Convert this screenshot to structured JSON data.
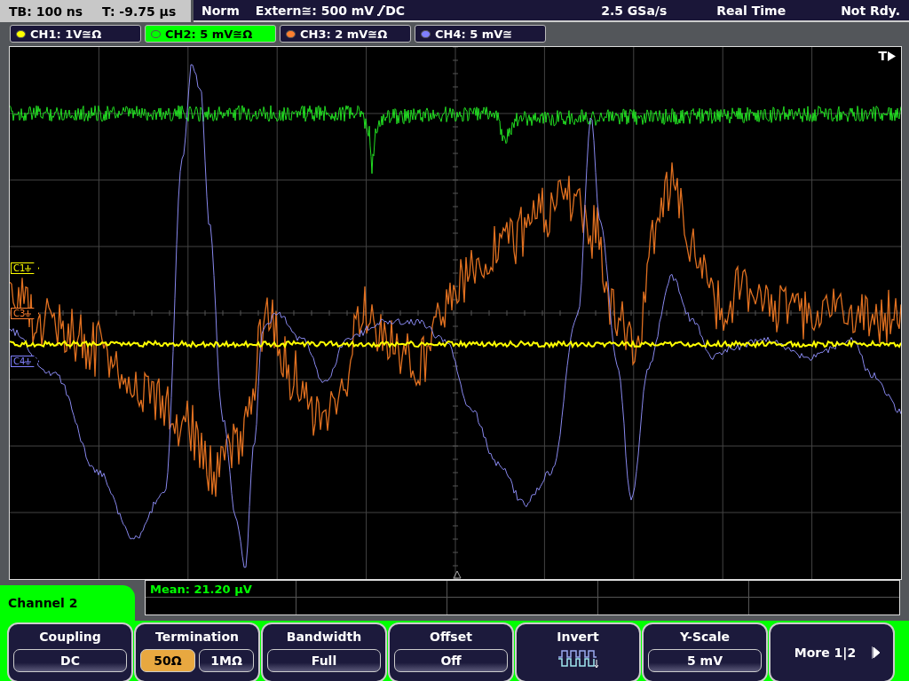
{
  "status_bar": {
    "timebase": "TB: 100 ns",
    "trigger_time": "T: -9.75 µs",
    "mode": "Norm",
    "trigger_source": "Extern≅: 500 mV",
    "trigger_coupling": "DC",
    "sample_rate": "2.5 GSa/s",
    "acquisition": "Real Time",
    "state": "Not Rdy."
  },
  "channel_tabs": [
    {
      "label": "CH1: 1V≅Ω",
      "color": "#ffff00",
      "selected": false
    },
    {
      "label": "CH2: 5 mV≅Ω",
      "color": "#00ff00",
      "selected": true
    },
    {
      "label": "CH3: 2 mV≅Ω",
      "color": "#ff8030",
      "selected": false
    },
    {
      "label": "CH4: 5 mV≅",
      "color": "#8080ff",
      "selected": false
    }
  ],
  "plot": {
    "trigger_label": "T",
    "markers": [
      {
        "label": "C1",
        "color": "#ffff00"
      },
      {
        "label": "C3",
        "color": "#ff8030"
      },
      {
        "label": "C4",
        "color": "#8080ff"
      }
    ]
  },
  "menu": {
    "title": "Channel 2",
    "measurement": "Mean: 21.20 µV",
    "softkeys": [
      {
        "kind": "value",
        "label": "Coupling",
        "value": "DC"
      },
      {
        "kind": "options",
        "label": "Termination",
        "options": [
          {
            "label": "50Ω",
            "selected": true
          },
          {
            "label": "1MΩ",
            "selected": false
          }
        ]
      },
      {
        "kind": "value",
        "label": "Bandwidth",
        "value": "Full"
      },
      {
        "kind": "value",
        "label": "Offset",
        "value": "Off"
      },
      {
        "kind": "icon",
        "label": "Invert"
      },
      {
        "kind": "value",
        "label": "Y-Scale",
        "value": "5 mV"
      },
      {
        "kind": "more",
        "label": "More 1|2"
      }
    ]
  }
}
